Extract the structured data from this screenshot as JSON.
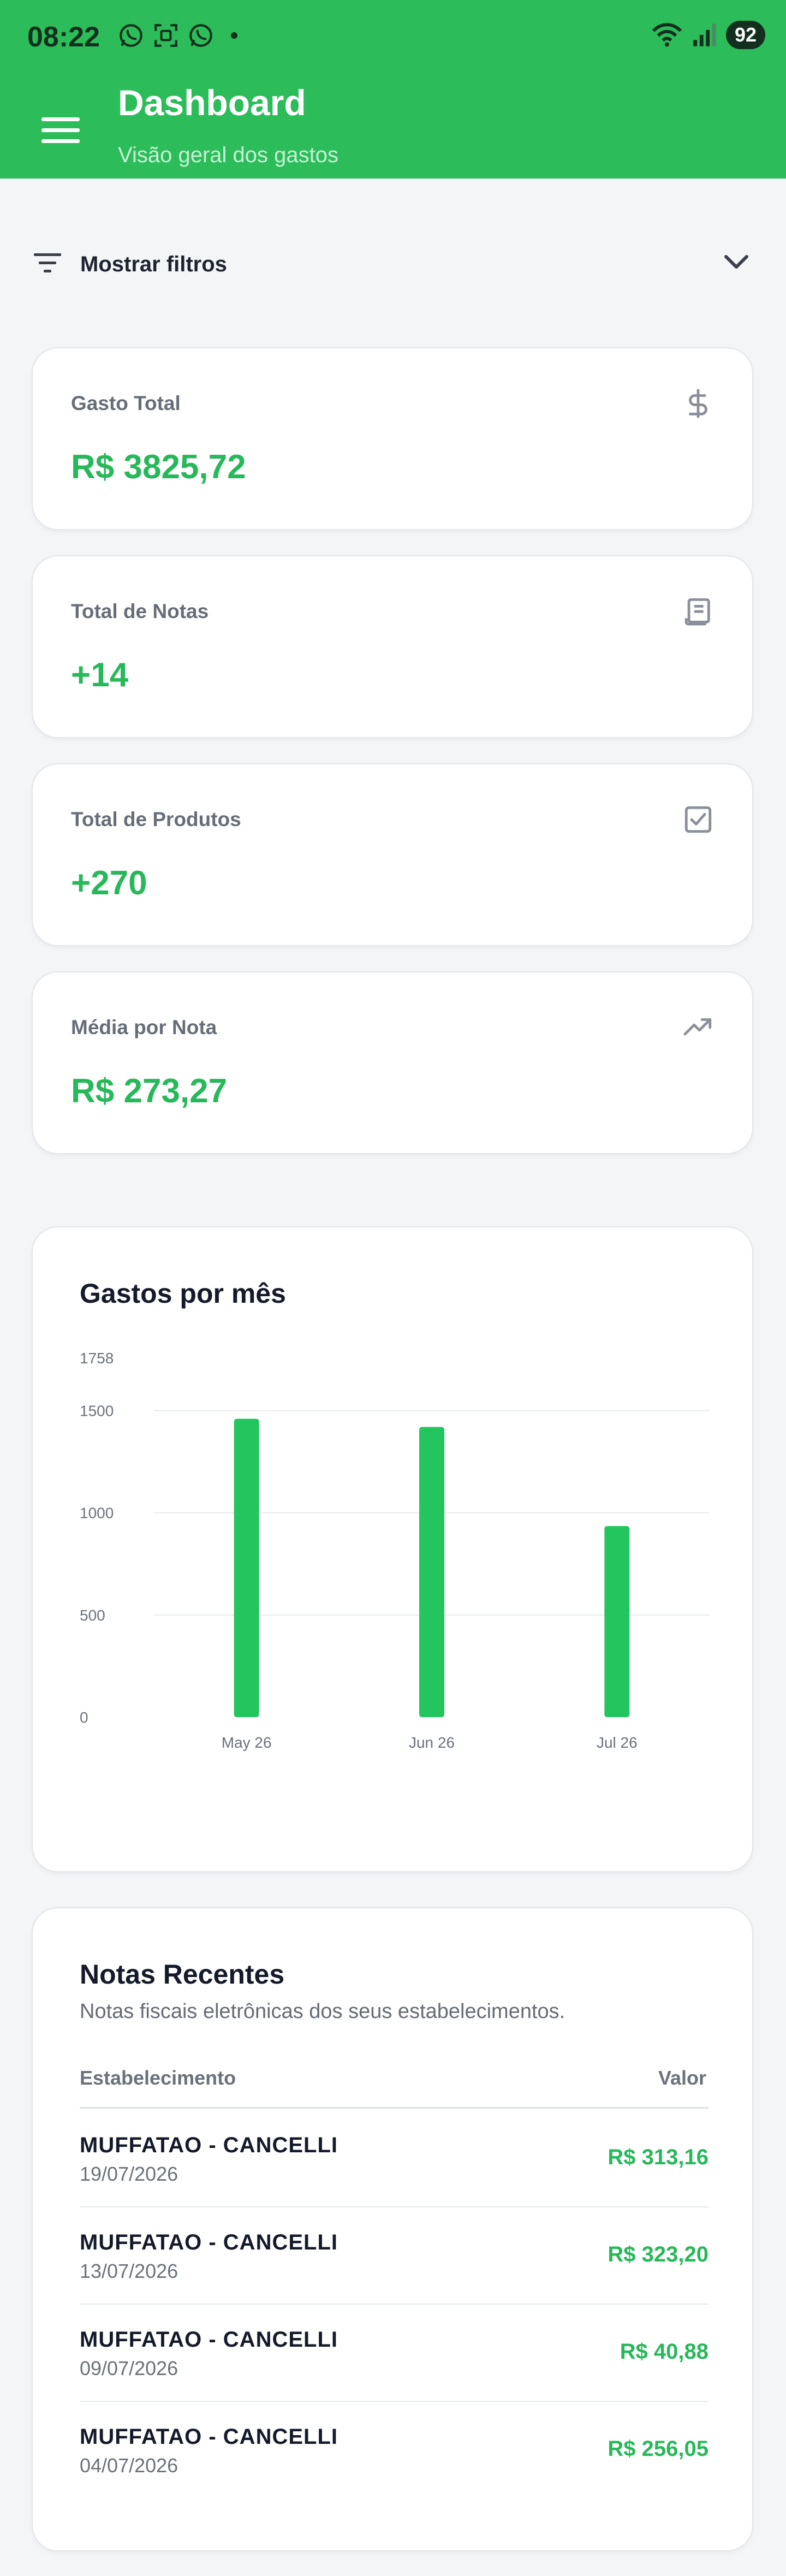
{
  "status_bar": {
    "time": "08:22",
    "battery": "92",
    "left_icons": [
      "whatsapp-icon",
      "scan-icon",
      "whatsapp-icon"
    ],
    "right_icons": [
      "wifi-icon",
      "signal-icon"
    ]
  },
  "header": {
    "title": "Dashboard",
    "subtitle": "Visão geral dos gastos",
    "color": "#2cbd5a"
  },
  "filters": {
    "label": "Mostrar filtros"
  },
  "stats": [
    {
      "label": "Gasto Total",
      "value": "R$ 3825,72",
      "icon": "dollar-icon"
    },
    {
      "label": "Total de Notas",
      "value": "+14",
      "icon": "receipt-icon"
    },
    {
      "label": "Total de Produtos",
      "value": "+270",
      "icon": "checkbox-icon"
    },
    {
      "label": "Média por Nota",
      "value": "R$ 273,27",
      "icon": "trending-up-icon"
    }
  ],
  "chart": {
    "title": "Gastos por mês"
  },
  "chart_data": {
    "type": "bar",
    "title": "Gastos por mês",
    "xlabel": "",
    "ylabel": "",
    "categories": [
      "May 26",
      "Jun 26",
      "Jul 26"
    ],
    "values": [
      1460,
      1420,
      935
    ],
    "ylim": [
      0,
      1758
    ],
    "yticks": [
      0,
      500,
      1000,
      1500,
      1758
    ],
    "grid": true,
    "legend": "none",
    "bar_color": "#22c55e"
  },
  "recent_notes": {
    "title": "Notas Recentes",
    "subtitle": "Notas fiscais eletrônicas dos seus estabelecimentos.",
    "columns": {
      "establishment": "Estabelecimento",
      "value": "Valor"
    },
    "rows": [
      {
        "name": "MUFFATAO - CANCELLI",
        "date": "19/07/2026",
        "value": "R$ 313,16"
      },
      {
        "name": "MUFFATAO - CANCELLI",
        "date": "13/07/2026",
        "value": "R$ 323,20"
      },
      {
        "name": "MUFFATAO - CANCELLI",
        "date": "09/07/2026",
        "value": "R$ 40,88"
      },
      {
        "name": "MUFFATAO - CANCELLI",
        "date": "04/07/2026",
        "value": "R$ 256,05"
      }
    ]
  }
}
